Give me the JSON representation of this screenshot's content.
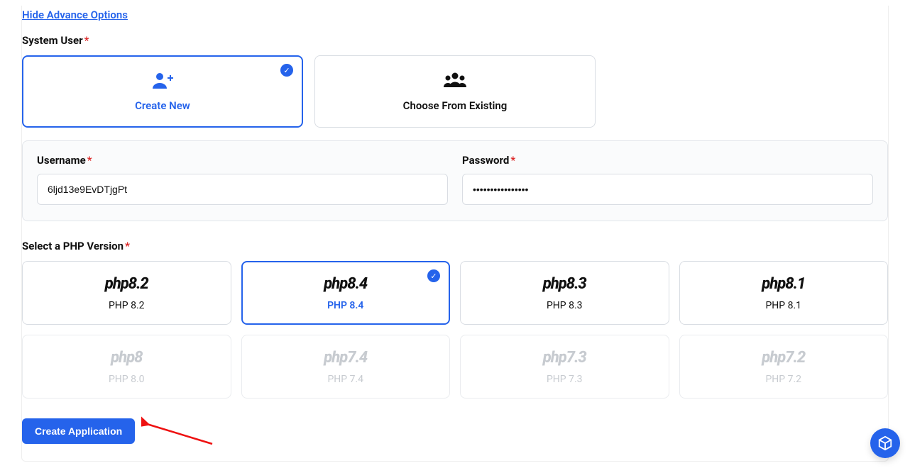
{
  "advanced_toggle_label": "Hide Advance Options",
  "system_user": {
    "label": "System User",
    "options": {
      "create_new": {
        "label": "Create New",
        "selected": true
      },
      "choose_existing": {
        "label": "Choose From Existing",
        "selected": false
      }
    }
  },
  "credentials": {
    "username": {
      "label": "Username",
      "value": "6ljd13e9EvDTjgPt"
    },
    "password": {
      "label": "Password",
      "value": "••••••••••••••••"
    }
  },
  "php_section": {
    "label": "Select a PHP Version",
    "selected": "PHP 8.4",
    "versions": [
      {
        "logo": "php8.2",
        "label": "PHP 8.2",
        "selected": false,
        "disabled": false
      },
      {
        "logo": "php8.4",
        "label": "PHP 8.4",
        "selected": true,
        "disabled": false
      },
      {
        "logo": "php8.3",
        "label": "PHP 8.3",
        "selected": false,
        "disabled": false
      },
      {
        "logo": "php8.1",
        "label": "PHP 8.1",
        "selected": false,
        "disabled": false
      },
      {
        "logo": "php8",
        "label": "PHP 8.0",
        "selected": false,
        "disabled": true
      },
      {
        "logo": "php7.4",
        "label": "PHP 7.4",
        "selected": false,
        "disabled": true
      },
      {
        "logo": "php7.3",
        "label": "PHP 7.3",
        "selected": false,
        "disabled": true
      },
      {
        "logo": "php7.2",
        "label": "PHP 7.2",
        "selected": false,
        "disabled": true
      }
    ]
  },
  "submit_button_label": "Create Application",
  "colors": {
    "primary": "#2563eb",
    "danger": "#dc2626",
    "border": "#d9dde3"
  }
}
